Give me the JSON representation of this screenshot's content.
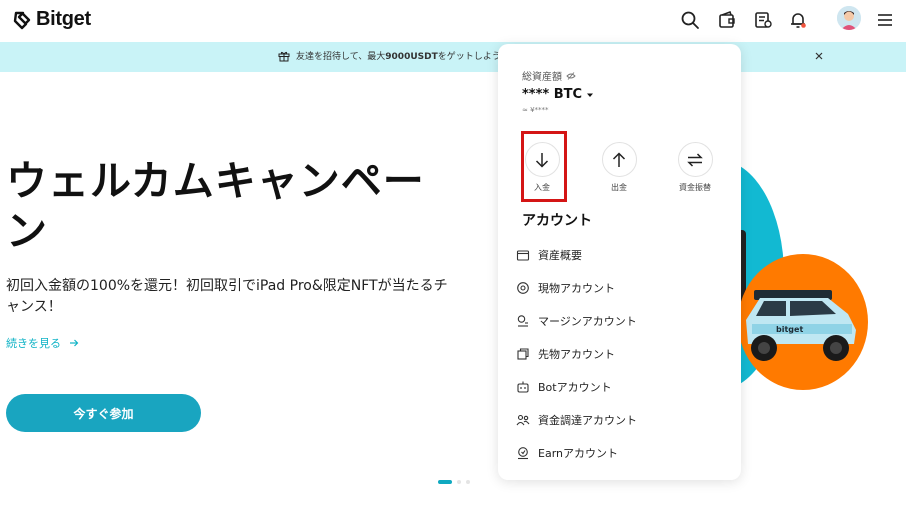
{
  "nav": {
    "logo_text": "Bitget",
    "icons": [
      "search-icon",
      "wallet-icon",
      "orders-icon",
      "bell-icon",
      "avatar",
      "menu-icon"
    ],
    "accent": "#19a5c0"
  },
  "banner": {
    "text": "友達を招待して、最大",
    "highlight": "9000USDT",
    "text_after": "をゲットしよう。詳",
    "background": "#c9f3f7"
  },
  "hero": {
    "title": "ウェルカムキャンペーン",
    "description": "初回入金額の100%を還元！初回取引でiPad Pro&限定NFTが当たるチャンス！",
    "link_label": "続きを見る",
    "cta_label": "今すぐ参加"
  },
  "assets_panel": {
    "label": "総資産額",
    "balance": "**** BTC",
    "sub_balance": "≈ ¥****",
    "actions": [
      {
        "label": "入金",
        "icon": "arrow-down-icon"
      },
      {
        "label": "出金",
        "icon": "arrow-up-icon"
      },
      {
        "label": "資金振替",
        "icon": "transfer-icon"
      }
    ],
    "section_title": "アカウント",
    "menu": [
      {
        "label": "資産概要",
        "icon": "wallet-icon"
      },
      {
        "label": "現物アカウント",
        "icon": "spot-icon"
      },
      {
        "label": "マージンアカウント",
        "icon": "margin-icon"
      },
      {
        "label": "先物アカウント",
        "icon": "futures-icon"
      },
      {
        "label": "Botアカウント",
        "icon": "bot-icon"
      },
      {
        "label": "資金調達アカウント",
        "icon": "funding-icon"
      },
      {
        "label": "Earnアカウント",
        "icon": "earn-icon"
      }
    ]
  },
  "pager": {
    "count": 3,
    "active_index": 0
  }
}
